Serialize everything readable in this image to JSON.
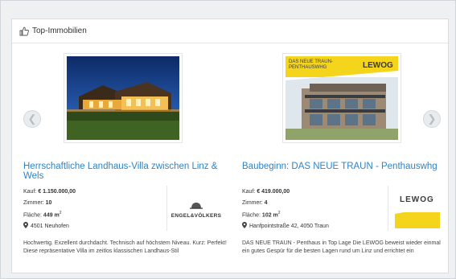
{
  "header": {
    "title": "Top-Immobilien",
    "icon": "thumbs-up-icon"
  },
  "nav": {
    "prev_icon": "chevron-left-icon",
    "next_icon": "chevron-right-icon",
    "prev_glyph": "❮",
    "next_glyph": "❯"
  },
  "listings": [
    {
      "title": "Herrschaftliche Landhaus-Villa zwischen Linz & Wels",
      "kauf_label": "Kauf:",
      "kauf_value": "€ 1.150.000,00",
      "zimmer_label": "Zimmer:",
      "zimmer_value": "10",
      "flaeche_label": "Fläche:",
      "flaeche_value": "449 m",
      "flaeche_sup": "2",
      "location": "4501 Neuhofen",
      "description": "Hochwertig. Exzellent durchdacht. Technisch auf höchstem Niveau. Kurz: Perfekt! Diese repräsentative Villa im zeitlos klassischen Landhaus-Stil",
      "agent": "ENGEL&VÖLKERS"
    },
    {
      "title": "Baubeginn: DAS NEUE TRAUN - Penthauswhg",
      "kauf_label": "Kauf:",
      "kauf_value": "€ 419.000,00",
      "zimmer_label": "Zimmer:",
      "zimmer_value": "4",
      "flaeche_label": "Fläche:",
      "flaeche_value": "102 m",
      "flaeche_sup": "2",
      "location": "Hanfpointstraße 42, 4050 Traun",
      "description": "DAS NEUE TRAUN - Penthaus in Top Lage Die LEWOG beweist wieder einmal ein gutes Gespür für die besten Lagen rund um Linz und errichtet ein",
      "agent": "LEWOG",
      "image_banner_line1": "DAS NEUE TRAUN-",
      "image_banner_line2": "PENTHAUSWHG",
      "image_logo": "LEWOG"
    }
  ],
  "colors": {
    "link": "#2f83c5",
    "lewog_yellow": "#f4d51c"
  }
}
